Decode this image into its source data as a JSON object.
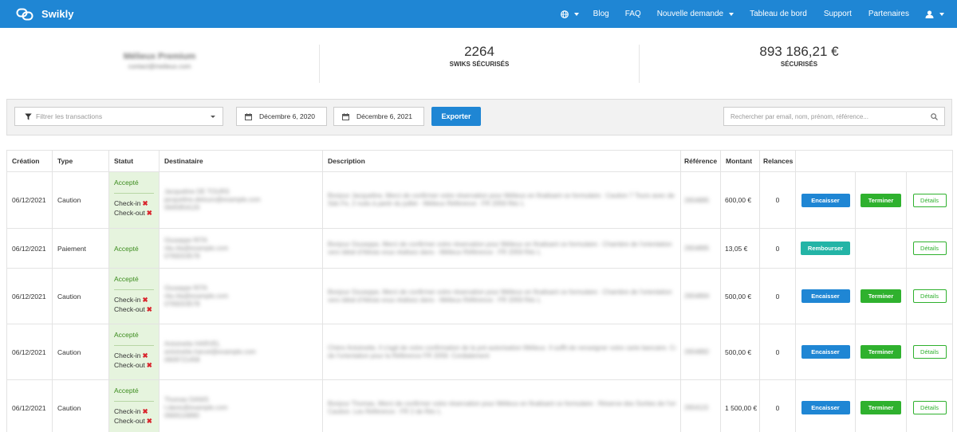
{
  "brand": {
    "name": "Swikly"
  },
  "nav": {
    "blog": "Blog",
    "faq": "FAQ",
    "new_request": "Nouvelle demande",
    "dashboard": "Tableau de bord",
    "support": "Support",
    "partners": "Partenaires"
  },
  "stats": {
    "user_name": "Mélieux Premium",
    "user_email": "contact@melieux.com",
    "swiks_count": "2264",
    "swiks_label": "SWIKS SÉCURISÉS",
    "amount": "893 186,21 €",
    "amount_label": "SÉCURISÉS"
  },
  "filters": {
    "filter_placeholder": "Filtrer les transactions",
    "date_from": "Décembre 6, 2020",
    "date_to": "Décembre 6, 2021",
    "export_label": "Exporter",
    "search_placeholder": "Rechercher par email, nom, prénom, référence..."
  },
  "table": {
    "headers": [
      "Création",
      "Type",
      "Statut",
      "Destinataire",
      "Description",
      "Référence",
      "Montant",
      "Relances",
      ""
    ],
    "labels": {
      "accepted": "Accepté",
      "checkin": "Check-in",
      "checkout": "Check-out",
      "cash": "Encaisser",
      "finish": "Terminer",
      "refund": "Rembourser",
      "details": "Détails"
    },
    "rows": [
      {
        "created": "06/12/2021",
        "type": "Caution",
        "status": "Accepté",
        "recipient": [
          "Jacqueline DE TOURS",
          "jacqueline.detours@example.com",
          "0645954120"
        ],
        "description": [
          "Bonjour Jacqueline, Merci de confirmer votre réservation pour Mélieux en finalisant ce formulaire : Caution 7 Tours avec de",
          "Sdo Fe, 2 nuits à partir du juillet - Mélieux Référence : FR 2059 Réc L"
        ],
        "reference": "2654885",
        "amount": "600,00 €",
        "reminders": "0"
      },
      {
        "created": "06/12/2021",
        "type": "Paiement",
        "status": "Accepté",
        "recipient": [
          "Giuseppe RITA",
          "rita.rita@example.com",
          "0769203578"
        ],
        "description": [
          "Bonjour Giuseppe, Merci de confirmer votre réservation pour Mélieux en finalisant ce formulaire : Chambre de l'orientation",
          "vers Idéal d'Alésia vous réalisez dans - Mélieux Référence : FR 2059 Réc L"
        ],
        "reference": "2654895",
        "amount": "13,05 €",
        "reminders": "0"
      },
      {
        "created": "06/12/2021",
        "type": "Caution",
        "status": "Accepté",
        "recipient": [
          "Giuseppe RITA",
          "rita.rita@example.com",
          "0769203578"
        ],
        "description": [
          "Bonjour Giuseppe, Merci de confirmer votre réservation pour Mélieux en finalisant ce formulaire : Chambre de l'orientation",
          "vers Idéal d'Alésia vous réalisez dans - Mélieux Référence : FR 2059 Réc L"
        ],
        "reference": "2654894",
        "amount": "500,00 €",
        "reminders": "0"
      },
      {
        "created": "06/12/2021",
        "type": "Caution",
        "status": "Accepté",
        "recipient": [
          "Antoinette HARVEL",
          "antoinette.harvel@example.com",
          "0609721458"
        ],
        "description": [
          "Chère Antoinette, Il s'agit de votre confirmation de la pré-autorisation Mélieux. Il suffit de renseigner votre carte bancaire. Cela n'a rien à voir avec",
          "de l'orientation pour la Référence FR 2059. Cordialement"
        ],
        "reference": "2654882",
        "amount": "500,00 €",
        "reminders": "0"
      },
      {
        "created": "06/12/2021",
        "type": "Caution",
        "status": "Accepté",
        "recipient": [
          "Thomas DANIS",
          "t.danis@example.com",
          "0669116890"
        ],
        "description": [
          "Bonjour Thomas, Merci de confirmer votre réservation pour Mélieux en finalisant ce formulaire : Réserve des Sorties de l'orientation de",
          "Caution. Les Référence : FR 2 de Réc L"
        ],
        "reference": "2654115",
        "amount": "1 500,00 €",
        "reminders": "0"
      }
    ]
  }
}
